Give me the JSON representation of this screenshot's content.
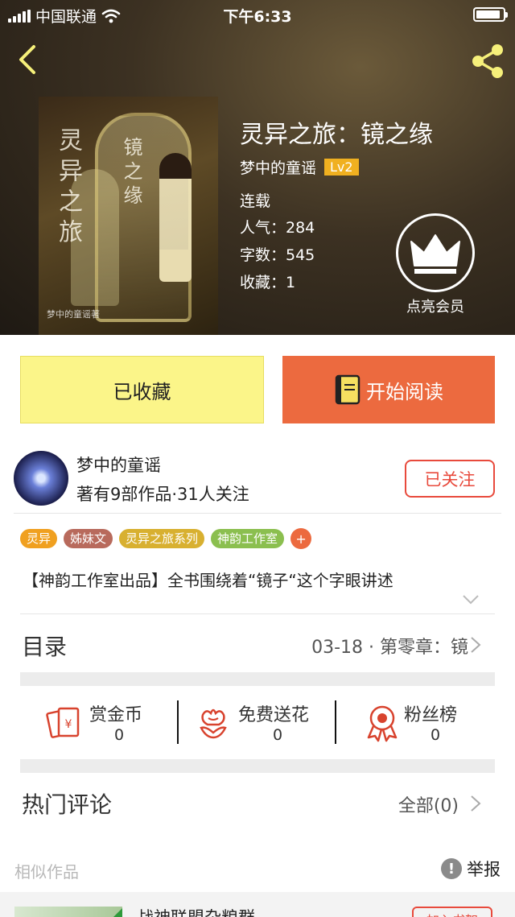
{
  "status_bar": {
    "carrier": "中国联通",
    "time": "下午6:33",
    "battery_level": 0.9
  },
  "book": {
    "title": "灵异之旅：镜之缘",
    "author": "梦中的童谣",
    "author_level": "Lv2",
    "status": "连载",
    "popularity": "人气：284",
    "word_count": "字数：545",
    "favorites": "收藏：1",
    "cover": {
      "title_line1": "灵异之旅",
      "title_line2": "镜之缘",
      "credit": "梦中的童谣著"
    }
  },
  "vip": {
    "label": "点亮会员"
  },
  "actions": {
    "collected_label": "已收藏",
    "read_label": "开始阅读"
  },
  "author_card": {
    "name": "梦中的童谣",
    "stats": "著有9部作品·31人关注",
    "follow_label": "已关注"
  },
  "tags": [
    {
      "label": "灵异",
      "color": "#f0a020"
    },
    {
      "label": "姊妹文",
      "color": "#b86a5c"
    },
    {
      "label": "灵异之旅系列",
      "color": "#d8b030"
    },
    {
      "label": "神韵工作室",
      "color": "#8bbf4f"
    }
  ],
  "tag_add_label": "+",
  "summary": "【神韵工作室出品】全书围绕着“镜子“这个字眼讲述",
  "toc": {
    "label": "目录",
    "latest": "03-18 · 第零章：镜"
  },
  "interactions": [
    {
      "title": "赏金币",
      "count": "0",
      "icon": "red-envelope-icon"
    },
    {
      "title": "免费送花",
      "count": "0",
      "icon": "flower-icon"
    },
    {
      "title": "粉丝榜",
      "count": "0",
      "icon": "medal-icon"
    }
  ],
  "comments": {
    "label": "热门评论",
    "all_label": "全部(0)"
  },
  "similar": {
    "label": "相似作品",
    "report_label": "举报",
    "report_icon": "!"
  },
  "similar_item": {
    "title": "战神联盟杂粮群",
    "add_label": "加入书架"
  },
  "colors": {
    "accent": "#ec6a3f",
    "collect_bg": "#fbf589",
    "follow_red": "#e84a3c"
  }
}
